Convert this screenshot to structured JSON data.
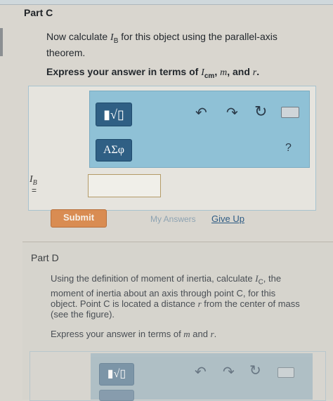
{
  "partC": {
    "title": "Part C",
    "prompt": {
      "pre": "Now calculate ",
      "var": "I",
      "sub": "B",
      "post": " for this object using the parallel-axis theorem."
    },
    "express": {
      "pre": "Express your answer in terms of ",
      "v1": "I",
      "v1sub": "cm",
      "sep1": ", ",
      "v2": "m",
      "sep2": ", and ",
      "v3": "r",
      "post": "."
    },
    "toolbar": {
      "template_label": "▮√▯",
      "symbols_label": "ΑΣφ",
      "undo_icon": "↶",
      "redo_icon": "↷",
      "reset_icon": "↻",
      "help_label": "?"
    },
    "answer_label": {
      "var": "I",
      "sub": "B",
      "eq": "="
    },
    "answer_value": "",
    "submit_label": "Submit",
    "my_answers_label": "My Answers",
    "give_up_label": "Give Up"
  },
  "partD": {
    "title": "Part D",
    "prompt": {
      "pre": "Using the definition of moment of inertia, calculate ",
      "var": "I",
      "sub": "C",
      "mid": ", the moment of inertia about an axis through point C, for this object. Point C is located a distance ",
      "r": "r",
      "post": " from the center of mass (see the figure)."
    },
    "express": {
      "pre": "Express your answer in terms of ",
      "v1": "m",
      "sep": " and ",
      "v2": "r",
      "post": "."
    },
    "toolbar": {
      "template_label": "▮√▯",
      "undo_icon": "↶",
      "redo_icon": "↷",
      "reset_icon": "↻"
    }
  },
  "colors": {
    "toolbar_bg": "#8fc1d6",
    "button_bg": "#2f5f84",
    "submit_bg": "#d98c52",
    "link": "#2f5c84"
  }
}
